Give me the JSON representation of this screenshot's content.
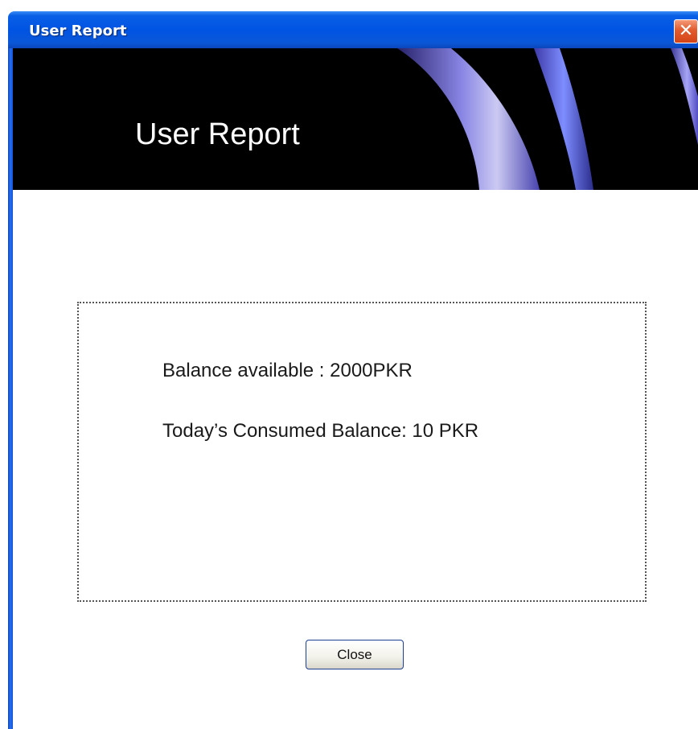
{
  "window": {
    "title": "User Report",
    "close_glyph": "✕",
    "close_icon": "close-icon"
  },
  "banner": {
    "heading": "User Report"
  },
  "report": {
    "balance_available": "Balance available : 2000PKR",
    "consumed_today": "Today’s Consumed Balance: 10 PKR"
  },
  "actions": {
    "close_label": "Close"
  },
  "colors": {
    "titlebar": "#0054e3",
    "banner_background": "#000000",
    "close_button_red": "#e25b2e",
    "banner_curve": "#8a86e8"
  }
}
